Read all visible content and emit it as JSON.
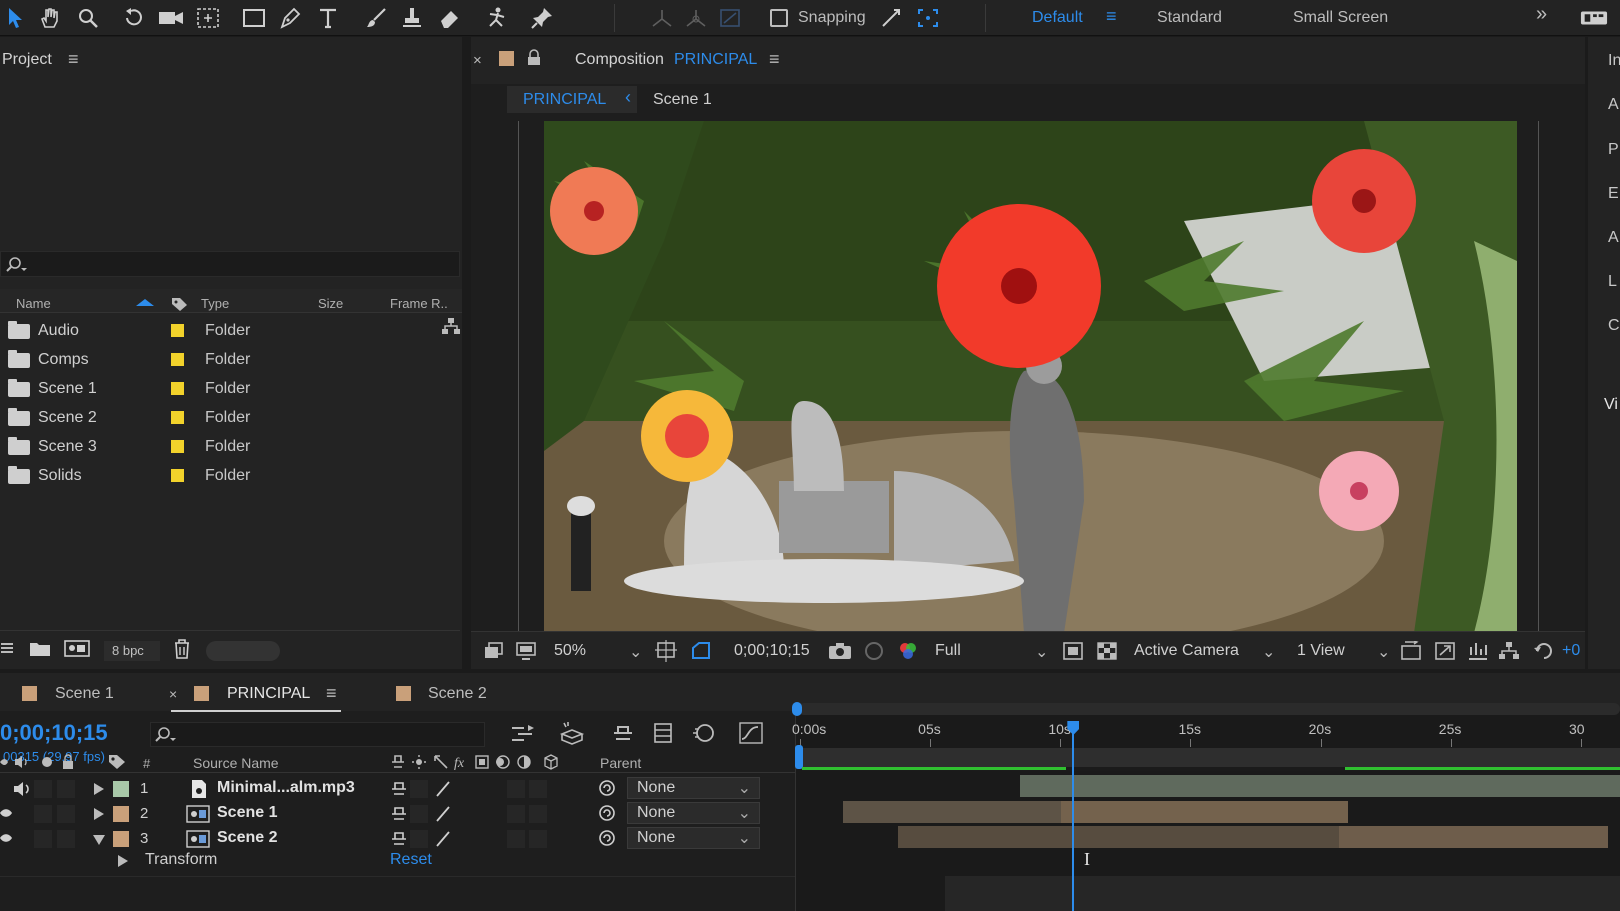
{
  "toolbar": {
    "snapping_label": "Snapping",
    "workspaces": [
      "Default",
      "Standard",
      "Small Screen"
    ],
    "more": "»"
  },
  "project": {
    "title": "Project",
    "menu": "≡",
    "columns": {
      "name": "Name",
      "type": "Type",
      "size": "Size",
      "frame_rate": "Frame R.."
    },
    "items": [
      {
        "name": "Audio",
        "type": "Folder"
      },
      {
        "name": "Comps",
        "type": "Folder"
      },
      {
        "name": "Scene 1",
        "type": "Folder"
      },
      {
        "name": "Scene 2",
        "type": "Folder"
      },
      {
        "name": "Scene 3",
        "type": "Folder"
      },
      {
        "name": "Solids",
        "type": "Folder"
      }
    ],
    "bpc": "8 bpc"
  },
  "composition": {
    "close": "×",
    "title_prefix": "Composition",
    "title_name": "PRINCIPAL",
    "breadcrumb_active": "PRINCIPAL",
    "breadcrumb_child": "Scene 1",
    "zoom": "50%",
    "timecode": "0;00;10;15",
    "resolution": "Full",
    "camera": "Active Camera",
    "views": "1 View",
    "exposure": "+0"
  },
  "right_panel": {
    "letters": [
      "In",
      "A",
      "P",
      "E",
      "A",
      "L",
      "C",
      "Vi"
    ]
  },
  "timeline": {
    "tabs": [
      {
        "label": "Scene 1",
        "color": "#c9a07a"
      },
      {
        "label": "PRINCIPAL",
        "color": "#c9a07a"
      },
      {
        "label": "Scene 2",
        "color": "#c9a07a"
      }
    ],
    "timecode": "0;00;10;15",
    "frame_info": "00315 (29.97 fps)",
    "columns": {
      "hash": "#",
      "source_name": "Source Name",
      "parent": "Parent"
    },
    "layers": [
      {
        "num": "1",
        "name": "Minimal...alm.mp3",
        "parent": "None",
        "label_color": "#a8c8a8"
      },
      {
        "num": "2",
        "name": "Scene 1",
        "parent": "None",
        "label_color": "#c9a07a"
      },
      {
        "num": "3",
        "name": "Scene 2",
        "parent": "None",
        "label_color": "#c9a07a"
      }
    ],
    "transform_label": "Transform",
    "reset_label": "Reset",
    "ruler": [
      "0:00s",
      "05s",
      "10s",
      "15s",
      "20s",
      "25s",
      "30"
    ],
    "current_seconds": 10.5,
    "visible_duration_seconds": 30
  },
  "colors": {
    "accent": "#2d8ceb",
    "label_yellow": "#f2d22b"
  }
}
